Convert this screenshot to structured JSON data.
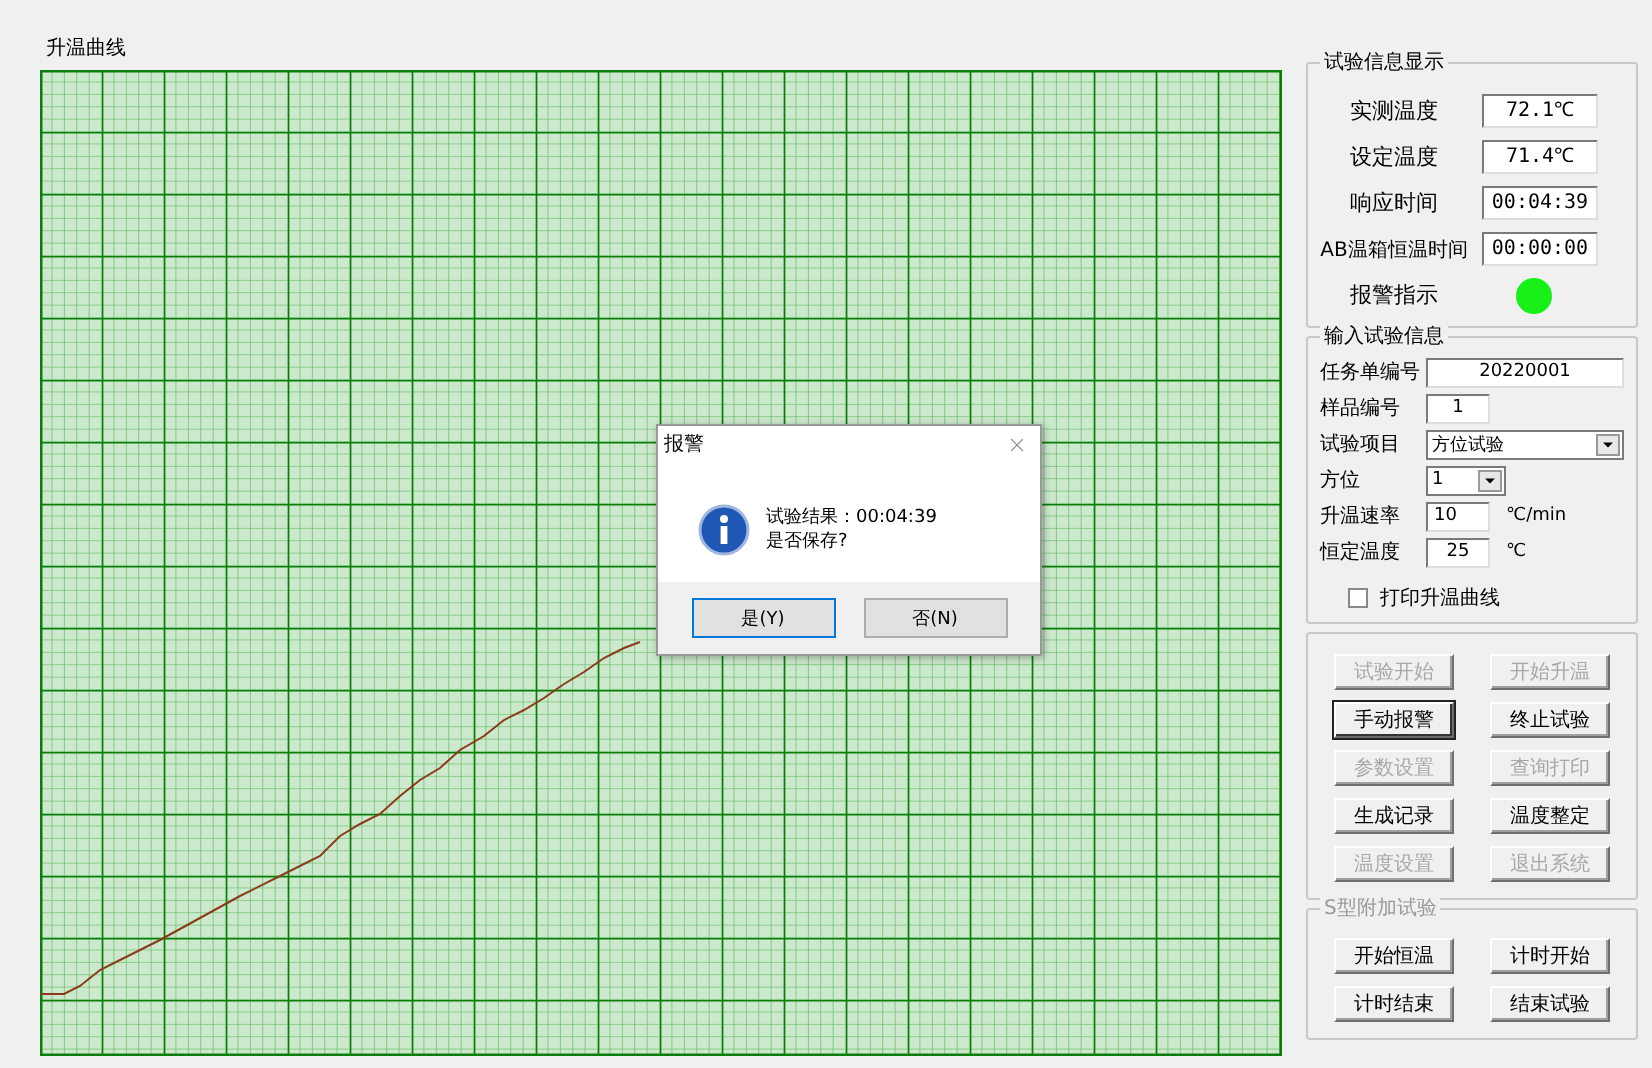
{
  "chart": {
    "title": "升温曲线"
  },
  "dialog": {
    "title": "报警",
    "lines": [
      "试验结果：00:04:39",
      "是否保存?"
    ],
    "buttons": [
      {
        "label": "是(Y)",
        "default": true
      },
      {
        "label": "否(N)",
        "default": false
      }
    ]
  },
  "info_group": {
    "title": "试验信息显示",
    "rows": [
      {
        "label": "实测温度",
        "value": "72.1℃"
      },
      {
        "label": "设定温度",
        "value": "71.4℃"
      },
      {
        "label": "响应时间",
        "value": "00:04:39"
      },
      {
        "label": "AB温箱恒温时间",
        "value": "00:00:00"
      }
    ],
    "alarm": {
      "label": "报警指示",
      "on": true
    }
  },
  "input_group": {
    "title": "输入试验信息",
    "fields": [
      {
        "kind": "text",
        "label": "任务单编号",
        "value": "20220001"
      },
      {
        "kind": "text",
        "label": "样品编号",
        "value": "1"
      },
      {
        "kind": "select",
        "label": "试验项目",
        "value": "方位试验"
      },
      {
        "kind": "select",
        "label": "方位",
        "value": "1"
      },
      {
        "kind": "text",
        "label": "升温速率",
        "value": "10",
        "unit": "℃/min"
      },
      {
        "kind": "text",
        "label": "恒定温度",
        "value": "25",
        "unit": "℃"
      }
    ],
    "checkbox": {
      "label": "打印升温曲线",
      "checked": false
    }
  },
  "control_buttons": [
    {
      "label": "试验开始",
      "disabled": true
    },
    {
      "label": "开始升温",
      "disabled": true
    },
    {
      "label": "手动报警",
      "disabled": false
    },
    {
      "label": "终止试验",
      "disabled": false
    },
    {
      "label": "参数设置",
      "disabled": true
    },
    {
      "label": "查询打印",
      "disabled": true
    },
    {
      "label": "生成记录",
      "disabled": false
    },
    {
      "label": "温度整定",
      "disabled": false
    },
    {
      "label": "温度设置",
      "disabled": true
    },
    {
      "label": "退出系统",
      "disabled": true
    }
  ],
  "s_group": {
    "title": "S型附加试验",
    "buttons": [
      {
        "label": "开始恒温",
        "disabled": false
      },
      {
        "label": "计时开始",
        "disabled": false
      },
      {
        "label": "计时结束",
        "disabled": false
      },
      {
        "label": "结束试验",
        "disabled": false
      }
    ]
  }
}
